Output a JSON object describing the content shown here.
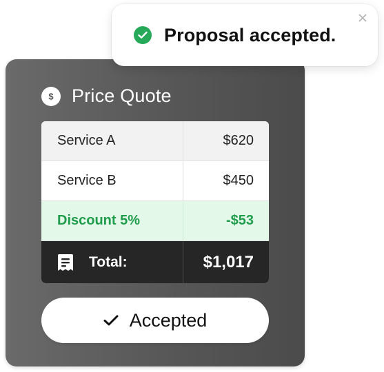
{
  "toast": {
    "message": "Proposal accepted.",
    "status_icon": "check-circle-icon",
    "close_icon": "close-icon",
    "accent_color": "#27a95a"
  },
  "card": {
    "title": "Price Quote",
    "title_icon": "dollar-icon",
    "rows": [
      {
        "label": "Service A",
        "value": "$620"
      },
      {
        "label": "Service B",
        "value": "$450"
      },
      {
        "label": "Discount 5%",
        "value": "-$53"
      }
    ],
    "total": {
      "icon": "receipt-icon",
      "label": "Total:",
      "value": "$1,017"
    },
    "discount_color": "#1f9d4c",
    "button": {
      "label": "Accepted",
      "icon": "check-icon"
    }
  }
}
